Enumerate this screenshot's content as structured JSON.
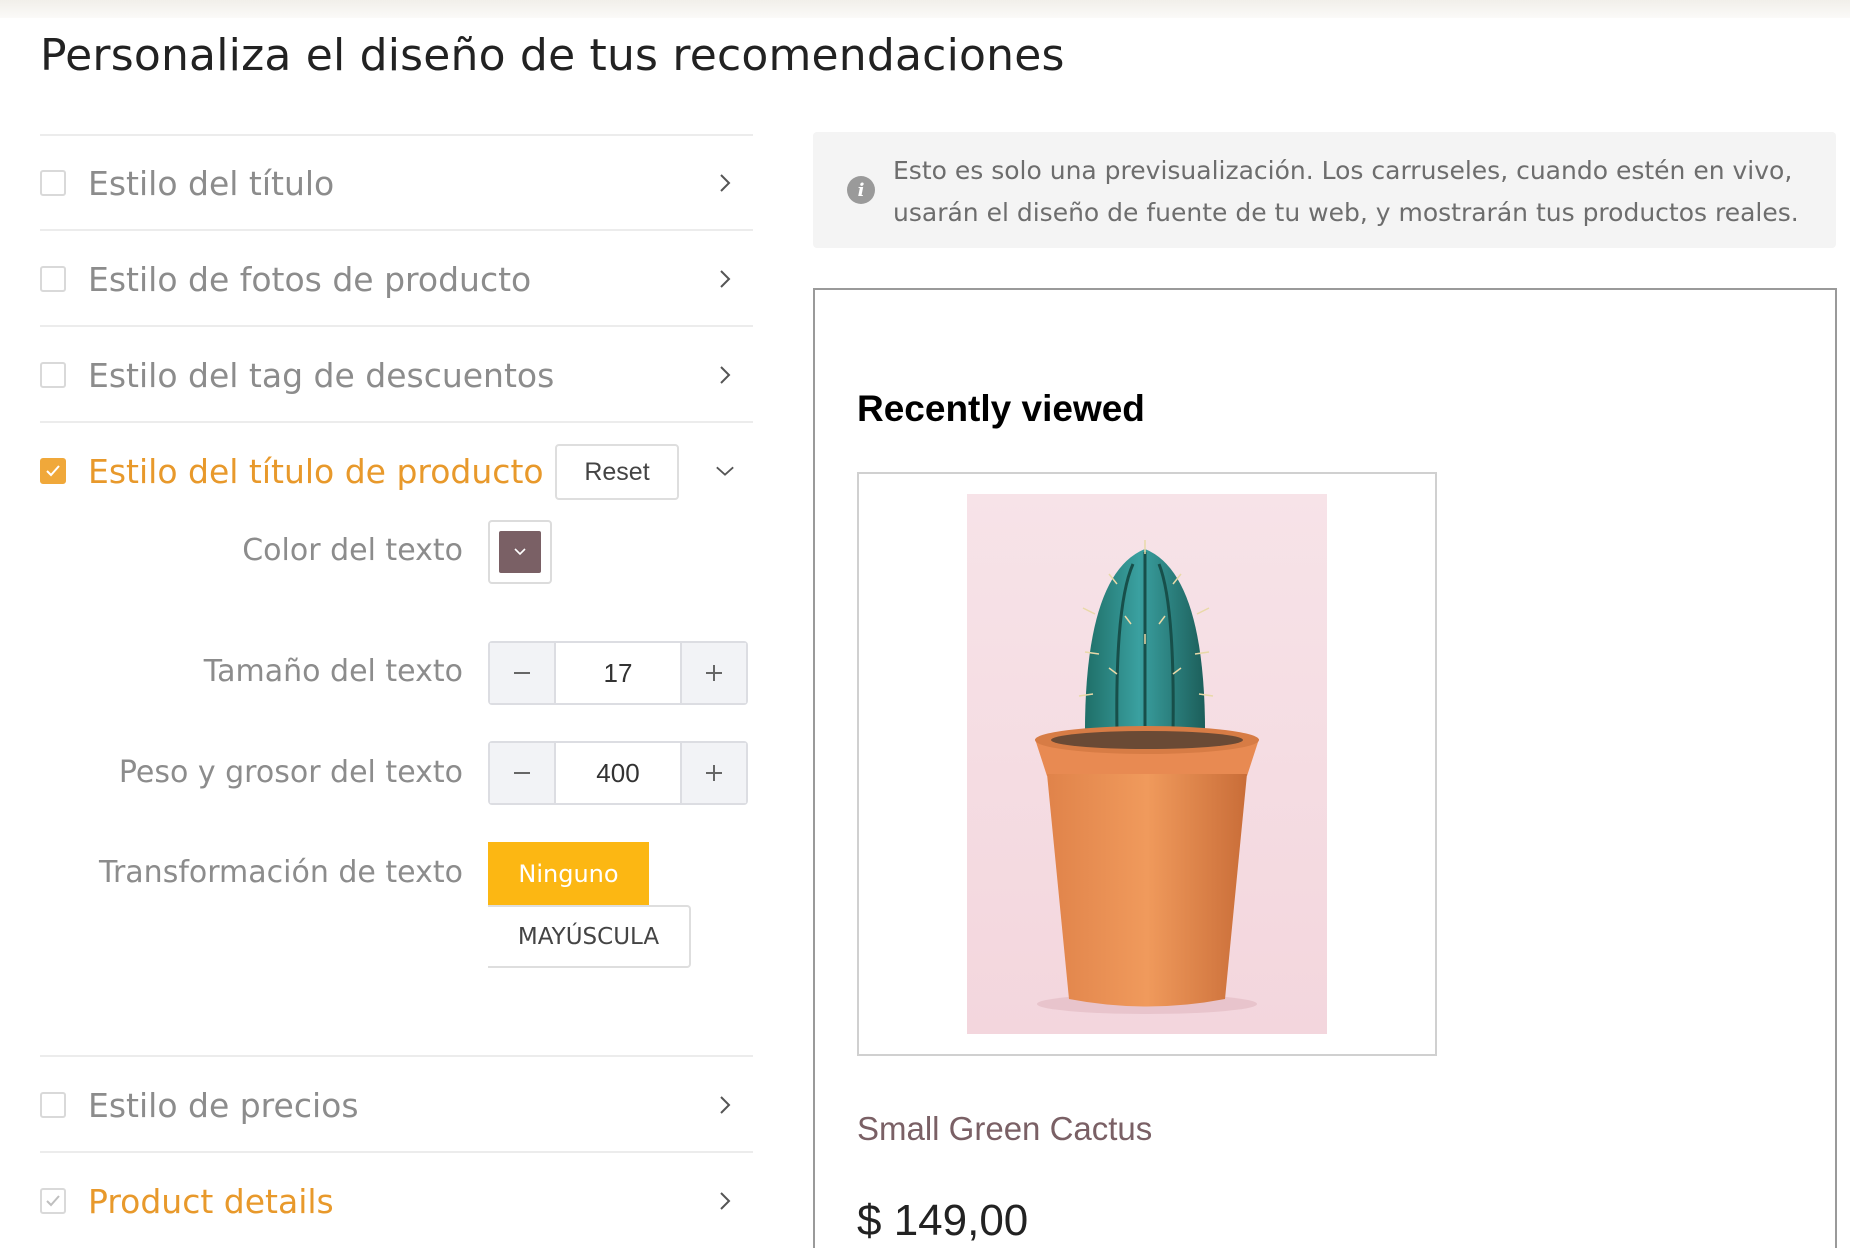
{
  "page": {
    "title": "Personaliza el diseño de tus recomendaciones"
  },
  "accordion": {
    "items": [
      {
        "label": "Estilo del título",
        "checked": false,
        "expanded": false
      },
      {
        "label": "Estilo de fotos de producto",
        "checked": false,
        "expanded": false
      },
      {
        "label": "Estilo del tag de descuentos",
        "checked": false,
        "expanded": false
      },
      {
        "label": "Estilo del título de producto",
        "checked": true,
        "expanded": true
      },
      {
        "label": "Estilo de precios",
        "checked": false,
        "expanded": false
      },
      {
        "label": "Product details",
        "checked": true,
        "expanded": false
      }
    ],
    "reset_label": "Reset"
  },
  "product_title_style": {
    "color_label": "Color del texto",
    "color_value": "#7a6065",
    "size_label": "Tamaño del texto",
    "size_value": "17",
    "weight_label": "Peso y grosor del texto",
    "weight_value": "400",
    "transform_label": "Transformación de texto",
    "transform_options": [
      "Ninguno",
      "MAYÚSCULA"
    ],
    "transform_selected": "Ninguno"
  },
  "preview": {
    "notice": "Esto es solo una previsualización. Los carruseles, cuando estén en vivo, usarán el diseño de fuente de tu web, y mostrarán tus productos reales.",
    "heading": "Recently viewed",
    "product_name": "Small Green Cactus",
    "product_price": "$ 149,00"
  },
  "colors": {
    "accent": "#e8992b",
    "button_active": "#fcb713",
    "product_title": "#7a6065"
  },
  "icons": {
    "info": "info-icon",
    "chevron_right": "chevron-right-icon",
    "chevron_down": "chevron-down-icon",
    "check": "check-icon",
    "minus": "minus-icon",
    "plus": "plus-icon"
  }
}
